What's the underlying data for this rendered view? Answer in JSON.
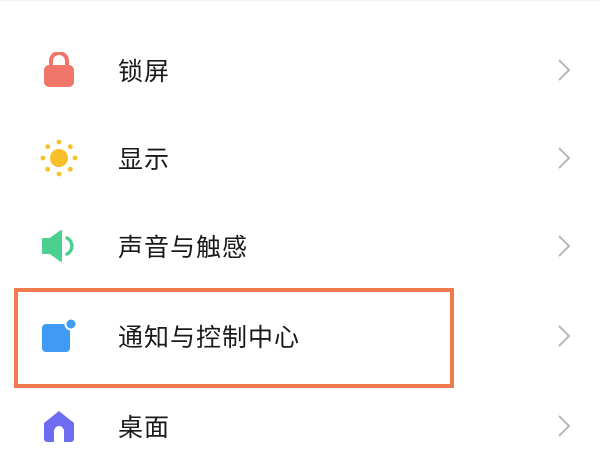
{
  "settings": {
    "items": [
      {
        "label": "锁屏",
        "icon": "lock-icon",
        "color": "#f0766a"
      },
      {
        "label": "显示",
        "icon": "sun-icon",
        "color": "#f7bf2a"
      },
      {
        "label": "声音与触感",
        "icon": "speaker-icon",
        "color": "#4cd08f"
      },
      {
        "label": "通知与控制中心",
        "icon": "notification-icon",
        "color": "#3f9bf4"
      },
      {
        "label": "桌面",
        "icon": "home-icon",
        "color": "#6e6cf0"
      }
    ]
  },
  "highlight": {
    "color": "#ee7a4e"
  }
}
